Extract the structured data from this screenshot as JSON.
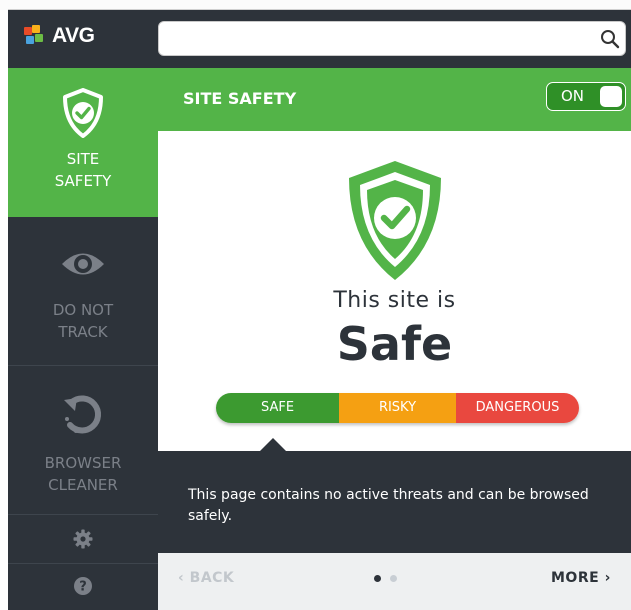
{
  "app": {
    "brand": "AVG"
  },
  "search": {
    "value": "",
    "placeholder": ""
  },
  "sidebar": {
    "items": [
      {
        "label_line1": "SITE",
        "label_line2": "SAFETY",
        "icon": "shield-check-icon",
        "active": true
      },
      {
        "label_line1": "DO NOT",
        "label_line2": "TRACK",
        "icon": "eye-icon",
        "active": false
      },
      {
        "label_line1": "BROWSER",
        "label_line2": "CLEANER",
        "icon": "refresh-icon",
        "active": false
      }
    ],
    "bottom_icons": [
      "gear-icon",
      "help-icon"
    ]
  },
  "panel": {
    "title": "SITE SAFETY",
    "toggle_label": "ON",
    "status_line1": "This site is",
    "status_line2": "Safe",
    "meter": {
      "safe": "SAFE",
      "risky": "RISKY",
      "dangerous": "DANGEROUS"
    },
    "description": "This page contains no active threats and can be browsed safely."
  },
  "footer": {
    "back_label": "BACK",
    "more_label": "MORE",
    "pages": 2,
    "current_page": 1
  },
  "colors": {
    "accent_green": "#53b448",
    "dark": "#2d333a",
    "risky_orange": "#f5a012",
    "danger_red": "#e9483f"
  }
}
